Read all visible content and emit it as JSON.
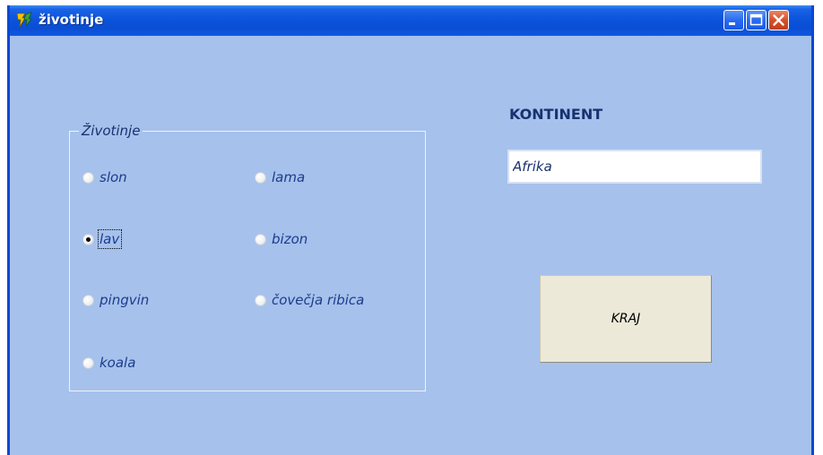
{
  "window": {
    "title": "životinje",
    "icon": "delphi-app-icon",
    "controls": [
      "minimize-icon",
      "maximize-icon",
      "close-icon"
    ]
  },
  "animals_group": {
    "title": "Životinje",
    "options": [
      {
        "label": "slon",
        "checked": false
      },
      {
        "label": "lama",
        "checked": false
      },
      {
        "label": "lav",
        "checked": true
      },
      {
        "label": "bizon",
        "checked": false
      },
      {
        "label": "pingvin",
        "checked": false
      },
      {
        "label": "čovečja ribica",
        "checked": false
      },
      {
        "label": "koala",
        "checked": false
      }
    ]
  },
  "continent": {
    "label": "KONTINENT",
    "value": "Afrika"
  },
  "exit_button": {
    "label": "KRAJ"
  },
  "colors": {
    "client_background": "#a6c1ec",
    "titlebar": "#0a4ed4",
    "label_text": "#17326e",
    "button_face": "#ece9d8"
  }
}
